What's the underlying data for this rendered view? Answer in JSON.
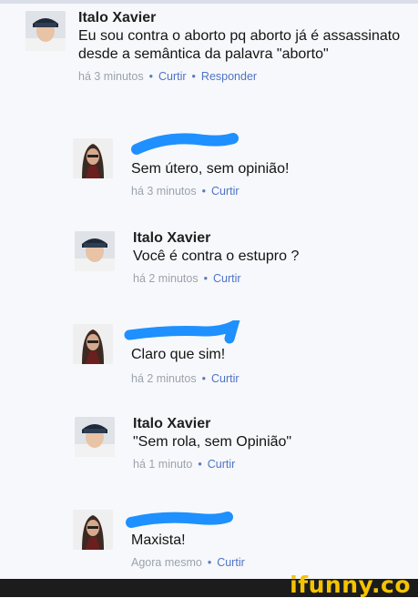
{
  "comments": [
    {
      "author": "Italo Xavier",
      "text": "Eu sou contra o aborto pq aborto já é assassinato desde a semântica da palavra \"aborto\"",
      "time": "há 3 minutos",
      "like": "Curtir",
      "reply": "Responder"
    },
    {
      "author": "",
      "text": "Sem útero, sem opinião!",
      "time": "há 3 minutos",
      "like": "Curtir"
    },
    {
      "author": "Italo Xavier",
      "text": "Você é contra o estupro ?",
      "time": "há 2 minutos",
      "like": "Curtir"
    },
    {
      "author": "",
      "text": "Claro que sim!",
      "time": "há 2 minutos",
      "like": "Curtir"
    },
    {
      "author": "Italo Xavier",
      "text": "\"Sem rola, sem Opinião\"",
      "time": "há 1 minuto",
      "like": "Curtir"
    },
    {
      "author": "",
      "text": "Maxista!",
      "time": "Agora mesmo",
      "like": "Curtir"
    }
  ],
  "watermark": "ifunny.co",
  "colors": {
    "link": "#4d73c7",
    "meta": "#9aa3ad",
    "redaction": "#1e90ff",
    "footer": "#1c1c1c",
    "brand": "#f5c400"
  }
}
